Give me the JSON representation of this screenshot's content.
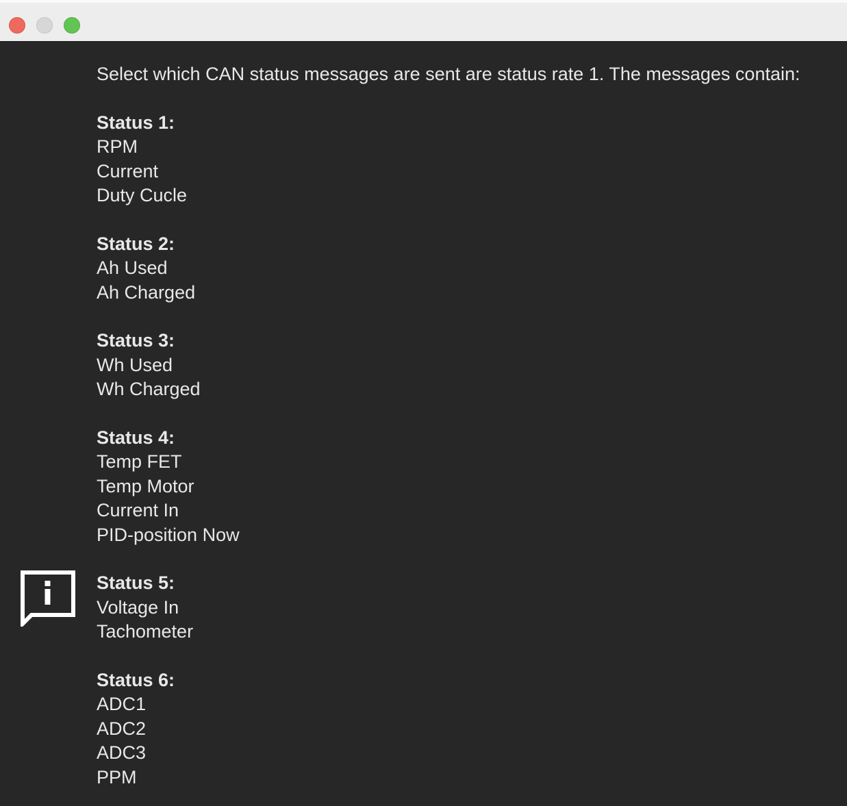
{
  "window": {
    "controls": [
      "close",
      "minimize",
      "maximize"
    ]
  },
  "help": {
    "icon": "info-message-icon",
    "intro": "Select which CAN status messages are sent are status rate 1. The messages contain:",
    "groups": [
      {
        "title": "Status 1:",
        "items": [
          "RPM",
          "Current",
          "Duty Cucle"
        ]
      },
      {
        "title": "Status 2:",
        "items": [
          "Ah Used",
          "Ah Charged"
        ]
      },
      {
        "title": "Status 3:",
        "items": [
          "Wh Used",
          "Wh Charged"
        ]
      },
      {
        "title": "Status 4:",
        "items": [
          "Temp FET",
          "Temp Motor",
          "Current In",
          "PID-position Now"
        ]
      },
      {
        "title": "Status 5:",
        "items": [
          "Voltage In",
          "Tachometer"
        ]
      },
      {
        "title": "Status 6:",
        "items": [
          "ADC1",
          "ADC2",
          "ADC3",
          "PPM"
        ]
      }
    ]
  },
  "colors": {
    "background": "#272727",
    "text": "#e8e8e8",
    "titlebar": "#ededed",
    "close": "#ee6a5e",
    "minimize": "#d7d7d7",
    "maximize": "#62c454"
  }
}
